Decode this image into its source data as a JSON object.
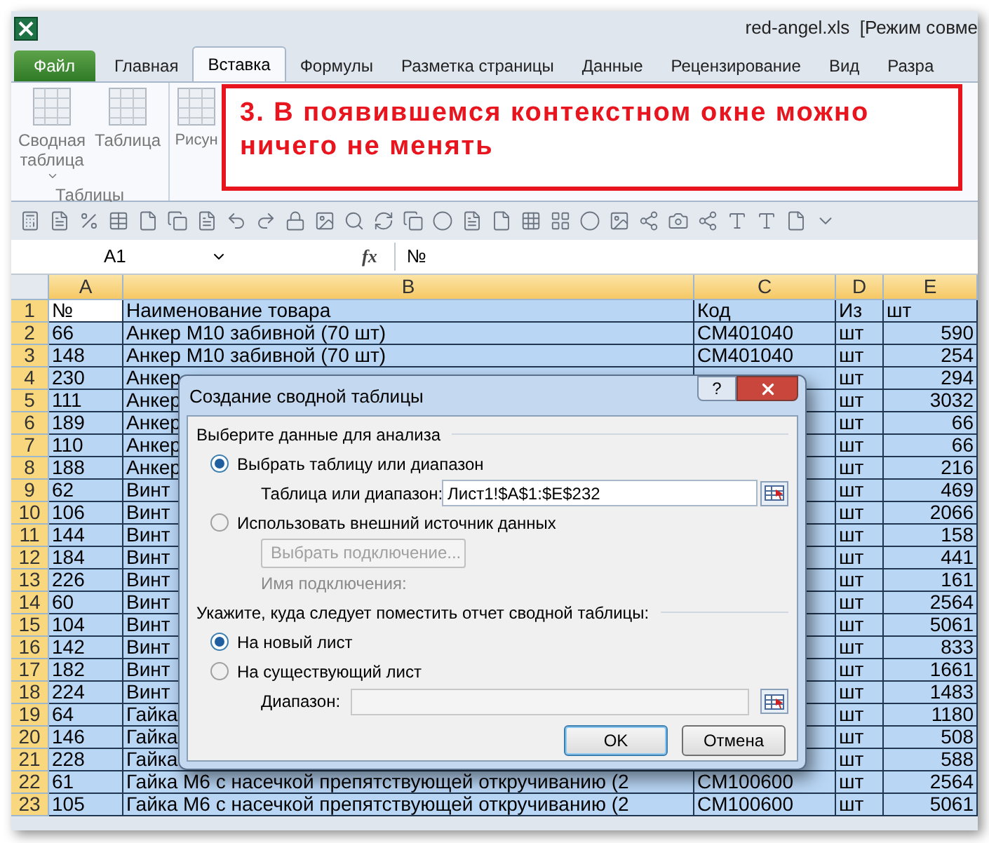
{
  "window": {
    "title": "red-angel.xls  [Режим совме"
  },
  "ribbon_tabs": [
    {
      "label": "Файл",
      "kind": "file",
      "selected": false
    },
    {
      "label": "Главная",
      "kind": "tab",
      "selected": false
    },
    {
      "label": "Вставка",
      "kind": "tab",
      "selected": true
    },
    {
      "label": "Формулы",
      "kind": "tab",
      "selected": false
    },
    {
      "label": "Разметка страницы",
      "kind": "tab",
      "selected": false
    },
    {
      "label": "Данные",
      "kind": "tab",
      "selected": false
    },
    {
      "label": "Рецензирование",
      "kind": "tab",
      "selected": false
    },
    {
      "label": "Вид",
      "kind": "tab",
      "selected": false
    },
    {
      "label": "Разра",
      "kind": "tab",
      "selected": false
    }
  ],
  "ribbon_groups": [
    {
      "label": "Таблицы",
      "buttons": [
        {
          "label": "Сводная таблица",
          "dropdown": true
        },
        {
          "label": "Таблица",
          "dropdown": false
        }
      ]
    },
    {
      "buttons": [
        {
          "label": "Рисун"
        }
      ]
    }
  ],
  "callout": {
    "text": "3. В появившемся контекстном окне можно ничего не менять"
  },
  "name_box": {
    "value": "A1"
  },
  "formula_bar": {
    "function_label": "fx",
    "value": "№"
  },
  "sheet": {
    "columns": [
      "A",
      "B",
      "C",
      "D",
      "E"
    ],
    "rows": [
      {
        "number": "1",
        "cells": [
          "№",
          "Наименование товара",
          "Код",
          "Из",
          "шт"
        ]
      },
      {
        "number": "2",
        "cells": [
          "66",
          "Анкер М10 забивной (70 шт)",
          "CM401040",
          "шт",
          "590"
        ]
      },
      {
        "number": "3",
        "cells": [
          "148",
          "Анкер М10 забивной (70 шт)",
          "CM401040",
          "шт",
          "254"
        ]
      },
      {
        "number": "4",
        "cells": [
          "230",
          "Анкер",
          null,
          "шт",
          "294"
        ]
      },
      {
        "number": "5",
        "cells": [
          "111",
          "Анкер",
          null,
          "шт",
          "3032"
        ]
      },
      {
        "number": "6",
        "cells": [
          "189",
          "Анкер",
          null,
          "шт",
          "66"
        ]
      },
      {
        "number": "7",
        "cells": [
          "110",
          "Анкер",
          null,
          "шт",
          "66"
        ]
      },
      {
        "number": "8",
        "cells": [
          "188",
          "Анкер",
          null,
          "шт",
          "216"
        ]
      },
      {
        "number": "9",
        "cells": [
          "62",
          "Винт",
          null,
          "шт",
          "469"
        ]
      },
      {
        "number": "10",
        "cells": [
          "106",
          "Винт",
          null,
          "шт",
          "2066"
        ]
      },
      {
        "number": "11",
        "cells": [
          "144",
          "Винт",
          null,
          "шт",
          "158"
        ]
      },
      {
        "number": "12",
        "cells": [
          "184",
          "Винт",
          null,
          "шт",
          "441"
        ]
      },
      {
        "number": "13",
        "cells": [
          "226",
          "Винт",
          null,
          "шт",
          "161"
        ]
      },
      {
        "number": "14",
        "cells": [
          "60",
          "Винт",
          null,
          "шт",
          "2564"
        ]
      },
      {
        "number": "15",
        "cells": [
          "104",
          "Винт",
          null,
          "шт",
          "5061"
        ]
      },
      {
        "number": "16",
        "cells": [
          "142",
          "Винт",
          null,
          "шт",
          "833"
        ]
      },
      {
        "number": "17",
        "cells": [
          "182",
          "Винт",
          null,
          "шт",
          "1661"
        ]
      },
      {
        "number": "18",
        "cells": [
          "224",
          "Винт",
          null,
          "шт",
          "1483"
        ]
      },
      {
        "number": "19",
        "cells": [
          "64",
          "Гайка",
          null,
          "шт",
          "1180"
        ]
      },
      {
        "number": "20",
        "cells": [
          "146",
          "Гайка",
          null,
          "шт",
          "508"
        ]
      },
      {
        "number": "21",
        "cells": [
          "228",
          "Гайка",
          null,
          "шт",
          "588"
        ]
      },
      {
        "number": "22",
        "cells": [
          "61",
          "Гайка М6 с насечкой препятствующей откручиванию (2",
          "CM100600",
          "шт",
          "2564"
        ]
      },
      {
        "number": "23",
        "cells": [
          "105",
          "Гайка М6 с насечкой препятствующей откручиванию (2",
          "CM100600",
          "шт",
          "5061"
        ]
      }
    ]
  },
  "dialog": {
    "title": "Создание сводной таблицы",
    "help": "?",
    "data_section": "Выберите данные для анализа",
    "source_options": [
      {
        "label": "Выбрать таблицу или диапазон",
        "selected": true
      },
      {
        "label": "Использовать внешний источник данных",
        "selected": false
      }
    ],
    "range_label": "Таблица или диапазон:",
    "range_value": "Лист1!$A$1:$E$232",
    "connection_button": {
      "label": "Выбрать подключение...",
      "disabled": true
    },
    "connection_label": {
      "text": "Имя подключения:",
      "disabled": true
    },
    "placement_section": "Укажите, куда следует поместить отчет сводной таблицы:",
    "placement_options": [
      {
        "label": "На новый лист",
        "selected": true
      },
      {
        "label": "На существующий лист",
        "selected": false
      }
    ],
    "location": {
      "label": "Диапазон:",
      "disabled": true
    },
    "buttons": [
      {
        "label": "OK",
        "kind": "default"
      },
      {
        "label": "Отмена",
        "kind": "normal"
      }
    ]
  }
}
